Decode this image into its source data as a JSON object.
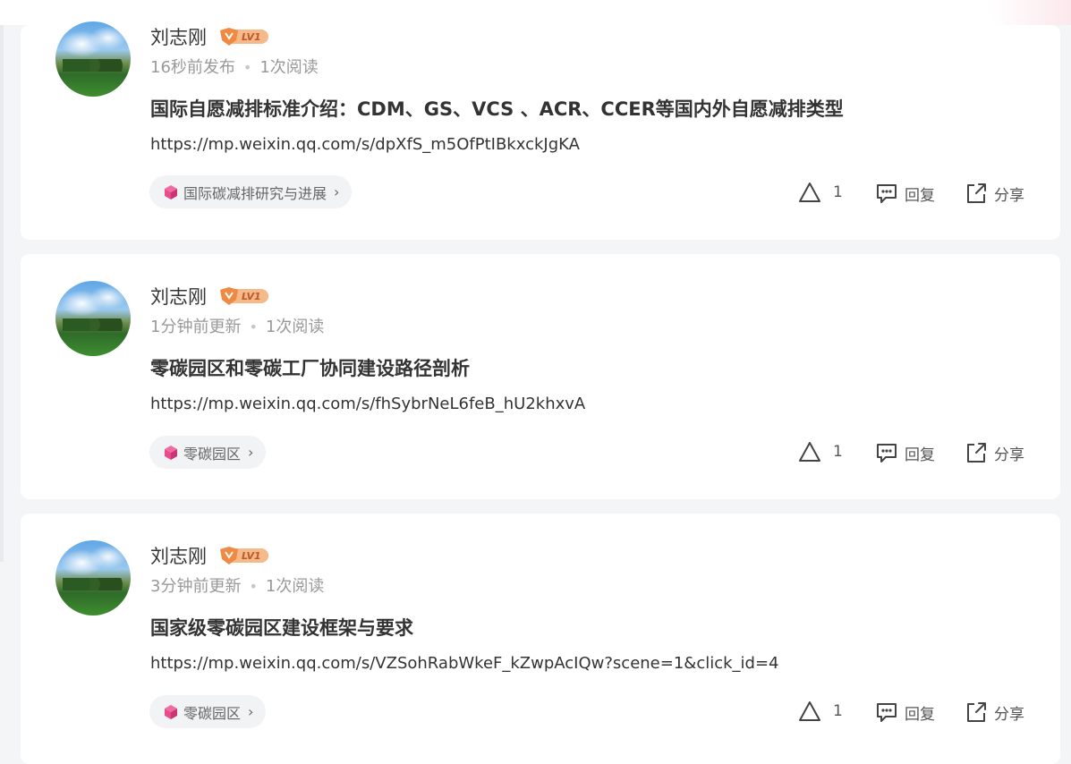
{
  "posts": [
    {
      "author": "刘志刚",
      "level": "LV1",
      "time": "16秒前发布",
      "reads": "1次阅读",
      "title": "国际自愿减排标准介绍：CDM、GS、VCS 、ACR、CCER等国内外自愿减排类型",
      "url": "https://mp.weixin.qq.com/s/dpXfS_m5OfPtIBkxckJgKA",
      "tag": "国际碳减排研究与进展",
      "likes": "1",
      "reply": "回复",
      "share": "分享"
    },
    {
      "author": "刘志刚",
      "level": "LV1",
      "time": "1分钟前更新",
      "reads": "1次阅读",
      "title": "零碳园区和零碳工厂协同建设路径剖析",
      "url": "https://mp.weixin.qq.com/s/fhSybrNeL6feB_hU2khxvA",
      "tag": "零碳园区",
      "likes": "1",
      "reply": "回复",
      "share": "分享"
    },
    {
      "author": "刘志刚",
      "level": "LV1",
      "time": "3分钟前更新",
      "reads": "1次阅读",
      "title": "国家级零碳园区建设框架与要求",
      "url": "https://mp.weixin.qq.com/s/VZSohRabWkeF_kZwpAcIQw?scene=1&click_id=4",
      "tag": "零碳园区",
      "likes": "1",
      "reply": "回复",
      "share": "分享"
    }
  ],
  "icons": {
    "like": "triangle-like-icon",
    "reply": "comment-bubble-icon",
    "share": "share-arrow-icon",
    "tag": "cube-icon",
    "chevron": "chevron-right-icon"
  },
  "colors": {
    "badge": "#f09a5a",
    "tag_icon": "#e84c8a"
  }
}
